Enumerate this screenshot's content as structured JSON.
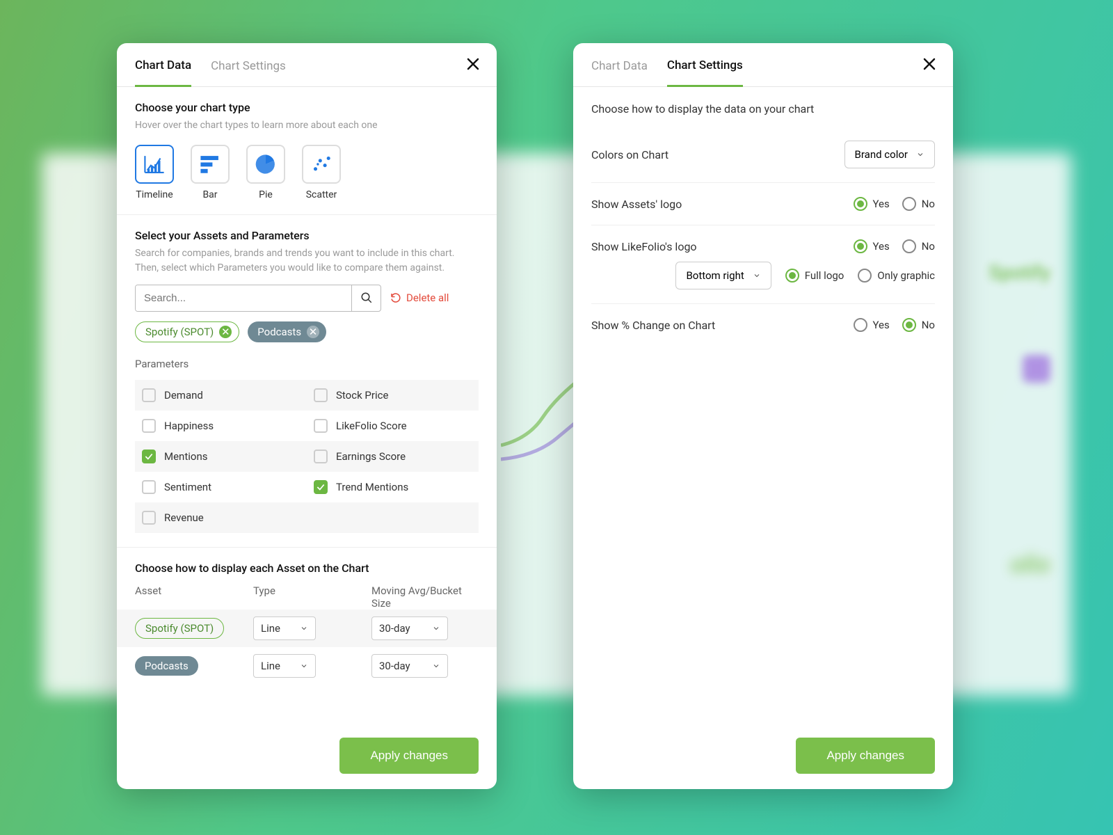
{
  "tabs": {
    "chart_data": "Chart Data",
    "chart_settings": "Chart Settings"
  },
  "chartData": {
    "typeSection": {
      "title": "Choose your chart type",
      "hint": "Hover over the chart types to learn more about each one",
      "types": [
        {
          "label": "Timeline"
        },
        {
          "label": "Bar"
        },
        {
          "label": "Pie"
        },
        {
          "label": "Scatter"
        }
      ]
    },
    "assetsSection": {
      "title": "Select your Assets and Parameters",
      "hint": "Search for companies, brands and trends you want to include in this chart. Then, select which Parameters you would like to compare them against.",
      "searchPlaceholder": "Search...",
      "deleteAll": "Delete all",
      "chips": [
        {
          "label": "Spotify (SPOT)"
        },
        {
          "label": "Podcasts"
        }
      ],
      "parametersTitle": "Parameters",
      "parameters": [
        [
          {
            "label": "Demand",
            "checked": false
          },
          {
            "label": "Stock Price",
            "checked": false
          }
        ],
        [
          {
            "label": "Happiness",
            "checked": false
          },
          {
            "label": "LikeFolio Score",
            "checked": false
          }
        ],
        [
          {
            "label": "Mentions",
            "checked": true
          },
          {
            "label": "Earnings Score",
            "checked": false
          }
        ],
        [
          {
            "label": "Sentiment",
            "checked": false
          },
          {
            "label": "Trend Mentions",
            "checked": true
          }
        ],
        [
          {
            "label": "Revenue",
            "checked": false
          }
        ]
      ]
    },
    "displaySection": {
      "title": "Choose how to display each Asset on the Chart",
      "headers": {
        "asset": "Asset",
        "type": "Type",
        "bucket": "Moving Avg/Bucket Size"
      },
      "rows": [
        {
          "asset": "Spotify (SPOT)",
          "type": "Line",
          "bucket": "30-day"
        },
        {
          "asset": "Podcasts",
          "type": "Line",
          "bucket": "30-day"
        }
      ]
    }
  },
  "settings": {
    "title": "Choose how to display the data on your chart",
    "colorsLabel": "Colors on Chart",
    "colorsValue": "Brand color",
    "assetsLogoLabel": "Show Assets' logo",
    "lfLogoLabel": "Show LikeFolio's logo",
    "lfPosition": "Bottom right",
    "fullLogo": "Full logo",
    "onlyGraphic": "Only graphic",
    "pctLabel": "Show % Change on Chart",
    "yes": "Yes",
    "no": "No"
  },
  "apply": "Apply changes"
}
